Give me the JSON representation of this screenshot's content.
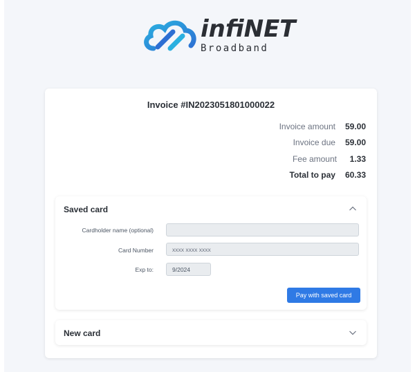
{
  "brand": {
    "name": "infiNET",
    "subtitle": "Broadband",
    "color_primary": "#2b9fd9",
    "color_secondary": "#2d6fd3"
  },
  "invoice": {
    "title": "Invoice #IN2023051801000022",
    "rows": [
      {
        "label": "Invoice amount",
        "value": "59.00"
      },
      {
        "label": "Invoice due",
        "value": "59.00"
      },
      {
        "label": "Fee amount",
        "value": "1.33"
      },
      {
        "label": "Total to pay",
        "value": "60.33"
      }
    ]
  },
  "saved_card": {
    "header": "Saved card",
    "expanded": true,
    "fields": {
      "cardholder_label": "Cardholder name (optional)",
      "cardholder_value": "",
      "card_number_label": "Card Number",
      "card_number_value": "xxxx xxxx xxxx",
      "exp_label": "Exp to:",
      "exp_value": "9/2024"
    },
    "pay_button": "Pay with saved card"
  },
  "new_card": {
    "header": "New card",
    "expanded": false
  },
  "icons": {
    "collapse": "chevron-up-icon",
    "expand": "chevron-down-icon",
    "logo": "cloud-logo-icon"
  }
}
